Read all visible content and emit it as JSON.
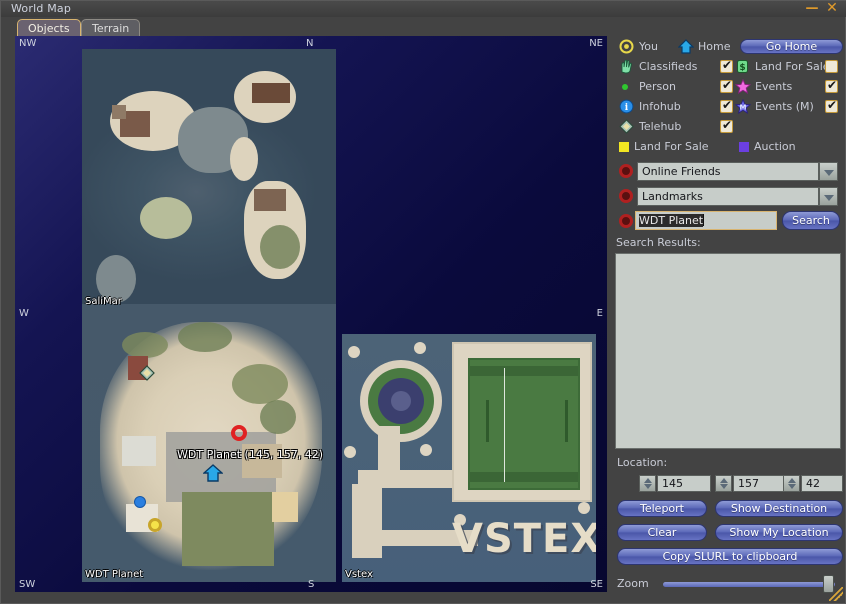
{
  "window": {
    "title": "World Map",
    "minimize_label": "—",
    "close_label": "✕"
  },
  "tabs": [
    {
      "label": "Objects",
      "active": true
    },
    {
      "label": "Terrain",
      "active": false
    }
  ],
  "map": {
    "compass": {
      "nw": "NW",
      "n": "N",
      "ne": "NE",
      "w": "W",
      "e": "E",
      "sw": "SW",
      "s": "S",
      "se": "SE"
    },
    "sim_labels": {
      "salimar": "SaliMar",
      "wdt": "WDT Planet",
      "vstex": "Vstex"
    },
    "overlay_text": "VSTEX",
    "tooltip": "WDT Planet (145, 157, 42)"
  },
  "legend": {
    "you_label": "You",
    "home_label": "Home",
    "go_home_label": "Go Home",
    "rows": [
      {
        "left_label": "Classifieds",
        "left_icon": "classifieds-icon",
        "left_checked": true,
        "right_label": "Land For Sale",
        "right_icon": "land-for-sale-icon",
        "right_checked": false
      },
      {
        "left_label": "Person",
        "left_icon": "person-icon",
        "left_checked": true,
        "right_label": "Events",
        "right_icon": "events-icon",
        "right_checked": true
      },
      {
        "left_label": "Infohub",
        "left_icon": "infohub-icon",
        "left_checked": true,
        "right_label": "Events (M)",
        "right_icon": "events-mature-icon",
        "right_checked": true
      },
      {
        "left_label": "Telehub",
        "left_icon": "telehub-icon",
        "left_checked": true,
        "right_label": "",
        "right_icon": "",
        "right_checked": null
      }
    ],
    "swatches": [
      {
        "label": "Land For Sale",
        "color": "#f2e622"
      },
      {
        "label": "Auction",
        "color": "#6b3fe0"
      }
    ]
  },
  "search": {
    "friends_value": "Online Friends",
    "landmarks_value": "Landmarks",
    "query_value": "WDT Planet",
    "search_button": "Search",
    "results_label": "Search Results:"
  },
  "location": {
    "label": "Location:",
    "x": "145",
    "y": "157",
    "z": "42"
  },
  "actions": {
    "teleport": "Teleport",
    "show_destination": "Show Destination",
    "clear": "Clear",
    "show_my_location": "Show My Location",
    "copy_slurl": "Copy SLURL to clipboard"
  },
  "zoom": {
    "label": "Zoom"
  }
}
